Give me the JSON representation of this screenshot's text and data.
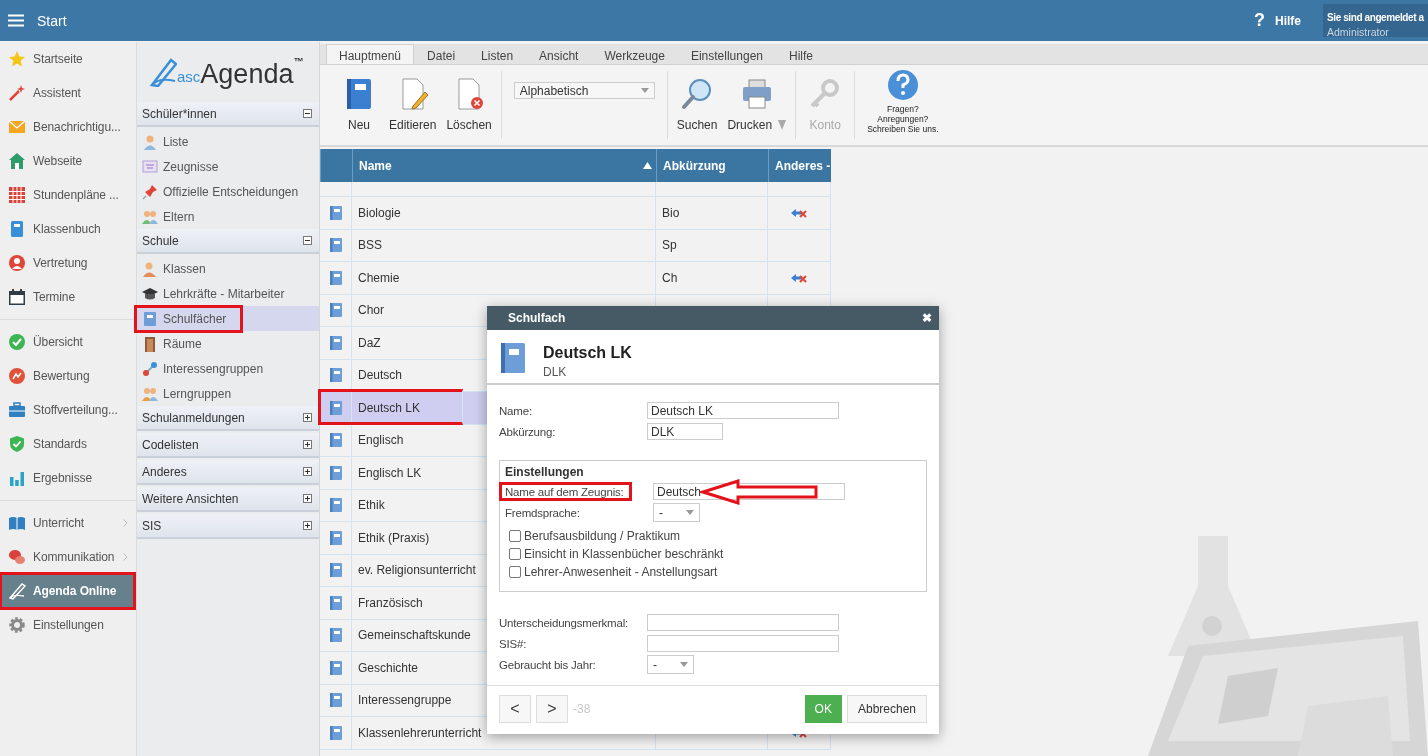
{
  "top_bar": {
    "title": "Start",
    "help_icon": "?",
    "help": "Hilfe",
    "user": {
      "line1": "Sie sind angemeldet a",
      "line2": "Administrator"
    }
  },
  "nav": {
    "groups": [
      {
        "items": [
          {
            "label": "Startseite",
            "selected": false,
            "highlighted": false,
            "submenu": false
          },
          {
            "label": "Assistent",
            "selected": false,
            "highlighted": false,
            "submenu": false
          },
          {
            "label": "Benachrichtigu...",
            "selected": false,
            "highlighted": false,
            "submenu": false
          },
          {
            "label": "Webseite",
            "selected": false,
            "highlighted": false,
            "submenu": false
          },
          {
            "label": "Stundenpläne ...",
            "selected": false,
            "highlighted": false,
            "submenu": false
          },
          {
            "label": "Klassenbuch",
            "selected": false,
            "highlighted": false,
            "submenu": false
          },
          {
            "label": "Vertretung",
            "selected": false,
            "highlighted": false,
            "submenu": false
          },
          {
            "label": "Termine",
            "selected": false,
            "highlighted": false,
            "submenu": false
          }
        ]
      },
      {
        "items": [
          {
            "label": "Übersicht",
            "selected": false,
            "highlighted": false,
            "submenu": false
          },
          {
            "label": "Bewertung",
            "selected": false,
            "highlighted": false,
            "submenu": false
          },
          {
            "label": "Stoffverteilung...",
            "selected": false,
            "highlighted": false,
            "submenu": false
          },
          {
            "label": "Standards",
            "selected": false,
            "highlighted": false,
            "submenu": false
          },
          {
            "label": "Ergebnisse",
            "selected": false,
            "highlighted": false,
            "submenu": false
          }
        ]
      },
      {
        "items": [
          {
            "label": "Unterricht",
            "selected": false,
            "highlighted": false,
            "submenu": true
          },
          {
            "label": "Kommunikation",
            "selected": false,
            "highlighted": false,
            "submenu": true
          },
          {
            "label": "Agenda Online",
            "selected": true,
            "highlighted": true,
            "submenu": false
          },
          {
            "label": "Einstellungen",
            "selected": false,
            "highlighted": false,
            "submenu": false
          }
        ]
      }
    ]
  },
  "subnav": {
    "logo": {
      "prefix": "asc",
      "name": "Agenda",
      "mark": "™"
    },
    "sections": [
      {
        "title": "Schüler*innen",
        "expanded": true,
        "items": [
          {
            "label": "Liste",
            "selected": false,
            "highlighted": false
          },
          {
            "label": "Zeugnisse",
            "selected": false,
            "highlighted": false
          },
          {
            "label": "Offizielle Entscheidungen",
            "selected": false,
            "highlighted": false
          },
          {
            "label": "Eltern",
            "selected": false,
            "highlighted": false
          }
        ]
      },
      {
        "title": "Schule",
        "expanded": true,
        "items": [
          {
            "label": "Klassen",
            "selected": false,
            "highlighted": false
          },
          {
            "label": "Lehrkräfte - Mitarbeiter",
            "selected": false,
            "highlighted": false
          },
          {
            "label": "Schulfächer",
            "selected": true,
            "highlighted": true
          },
          {
            "label": "Räume",
            "selected": false,
            "highlighted": false
          },
          {
            "label": "Interessengruppen",
            "selected": false,
            "highlighted": false
          },
          {
            "label": "Lerngruppen",
            "selected": false,
            "highlighted": false
          }
        ]
      },
      {
        "title": "Schulanmeldungen",
        "expanded": false
      },
      {
        "title": "Codelisten",
        "expanded": false
      },
      {
        "title": "Anderes",
        "expanded": false
      },
      {
        "title": "Weitere Ansichten",
        "expanded": false
      },
      {
        "title": "SIS",
        "expanded": false
      }
    ]
  },
  "menu_tabs": [
    {
      "label": "Hauptmenü",
      "selected": true
    },
    {
      "label": "Datei",
      "selected": false
    },
    {
      "label": "Listen",
      "selected": false
    },
    {
      "label": "Ansicht",
      "selected": false
    },
    {
      "label": "Werkzeuge",
      "selected": false
    },
    {
      "label": "Einstellungen",
      "selected": false
    },
    {
      "label": "Hilfe",
      "selected": false
    }
  ],
  "toolbar": {
    "groups": [
      {
        "kind": "buttons",
        "items": [
          {
            "label": "Neu",
            "disabled": false,
            "dropdown": false
          },
          {
            "label": "Editieren",
            "disabled": false,
            "dropdown": false
          },
          {
            "label": "Löschen",
            "disabled": false,
            "dropdown": false
          }
        ]
      },
      {
        "kind": "dropdown",
        "value": "Alphabetisch"
      },
      {
        "kind": "buttons",
        "items": [
          {
            "label": "Suchen",
            "disabled": false,
            "dropdown": false
          },
          {
            "label": "Drucken",
            "disabled": false,
            "dropdown": true
          }
        ]
      },
      {
        "kind": "buttons",
        "items": [
          {
            "label": "Konto",
            "disabled": true,
            "dropdown": false
          }
        ]
      },
      {
        "kind": "help",
        "lines": [
          "Fragen?",
          "Anregungen?",
          "Schreiben Sie uns."
        ]
      }
    ]
  },
  "table": {
    "columns": [
      {
        "label": "Name",
        "sorted": true
      },
      {
        "label": "Abkürzung",
        "sorted": false
      },
      {
        "label": "Anderes -",
        "sorted": false
      }
    ],
    "rows": [
      {
        "name": "Biologie",
        "abbreviation": "Bio",
        "linked": true,
        "selected": false,
        "highlighted": false
      },
      {
        "name": "BSS",
        "abbreviation": "Sp",
        "linked": false,
        "selected": false,
        "highlighted": false
      },
      {
        "name": "Chemie",
        "abbreviation": "Ch",
        "linked": true,
        "selected": false,
        "highlighted": false
      },
      {
        "name": "Chor",
        "linked": false,
        "selected": false,
        "highlighted": false
      },
      {
        "name": "DaZ",
        "linked": false,
        "selected": false,
        "highlighted": false
      },
      {
        "name": "Deutsch",
        "linked": false,
        "selected": false,
        "highlighted": false
      },
      {
        "name": "Deutsch LK",
        "linked": false,
        "selected": true,
        "highlighted": true
      },
      {
        "name": "Englisch",
        "linked": false,
        "selected": false,
        "highlighted": false
      },
      {
        "name": "Englisch LK",
        "linked": false,
        "selected": false,
        "highlighted": false
      },
      {
        "name": "Ethik",
        "linked": false,
        "selected": false,
        "highlighted": false
      },
      {
        "name": "Ethik (Praxis)",
        "linked": false,
        "selected": false,
        "highlighted": false
      },
      {
        "name": "ev. Religionsunterricht",
        "linked": false,
        "selected": false,
        "highlighted": false
      },
      {
        "name": "Französisch",
        "linked": false,
        "selected": false,
        "highlighted": false
      },
      {
        "name": "Gemeinschaftskunde",
        "linked": false,
        "selected": false,
        "highlighted": false
      },
      {
        "name": "Geschichte",
        "linked": false,
        "selected": false,
        "highlighted": false
      },
      {
        "name": "Interessengruppe",
        "linked": false,
        "selected": false,
        "highlighted": false
      },
      {
        "name": "Klassenlehrerunterricht",
        "linked": true,
        "selected": false,
        "highlighted": false
      }
    ]
  },
  "dialog": {
    "title": "Schulfach",
    "close": "✖",
    "subject": {
      "name": "Deutsch LK",
      "code": "DLK"
    },
    "fields": [
      {
        "label": "Name:",
        "value": "Deutsch LK",
        "kind": "text"
      },
      {
        "label": "Abkürzung:",
        "value": "DLK",
        "kind": "short"
      }
    ],
    "settings": {
      "title": "Einstellungen",
      "fields": [
        {
          "label": "Name auf dem Zeugnis:",
          "value": "Deutsch",
          "kind": "text",
          "highlighted": true,
          "arrow": true
        },
        {
          "label": "Fremdsprache:",
          "value": "-",
          "kind": "select",
          "highlighted": false,
          "arrow": false
        }
      ],
      "checkboxes": [
        {
          "label": "Berufsausbildung / Praktikum",
          "checked": false
        },
        {
          "label": "Einsicht in Klassenbücher beschränkt",
          "checked": false
        },
        {
          "label": "Lehrer-Anwesenheit - Anstellungsart",
          "checked": false
        }
      ]
    },
    "extra_fields": [
      {
        "label": "Unterscheidungsmerkmal:",
        "kind": "text"
      },
      {
        "label": "SIS#:",
        "kind": "text"
      },
      {
        "label": "Gebraucht bis Jahr:",
        "value": "-",
        "kind": "select"
      }
    ],
    "nav_buttons": [
      "<",
      ">"
    ],
    "record": "-38",
    "buttons": [
      {
        "label": "OK",
        "kind": "primary"
      },
      {
        "label": "Abbrechen",
        "kind": "secondary"
      }
    ]
  }
}
